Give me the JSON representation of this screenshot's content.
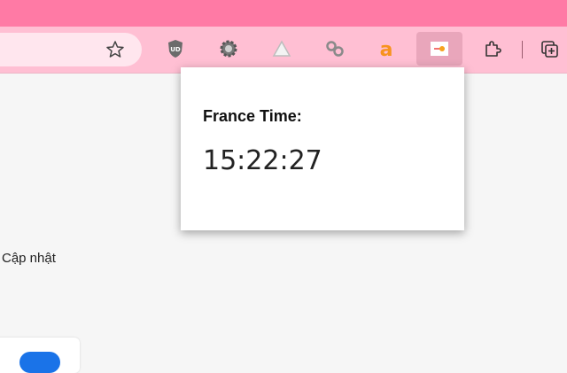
{
  "browser": {
    "toolbar_icons": [
      {
        "name": "star-icon"
      },
      {
        "name": "ublock-icon",
        "label": "UD"
      },
      {
        "name": "gear-icon"
      },
      {
        "name": "triangle-icon"
      },
      {
        "name": "link-icon"
      },
      {
        "name": "amazon-icon",
        "label": "a"
      },
      {
        "name": "france-time-icon"
      },
      {
        "name": "extensions-puzzle-icon"
      },
      {
        "name": "collections-icon"
      }
    ]
  },
  "page": {
    "side_text": "Cập nhật"
  },
  "popup": {
    "label": "France Time:",
    "time": "15:22:27"
  },
  "colors": {
    "titlebar": "#ff7aa5",
    "toolbar": "#ffbfd3",
    "toggle_accent": "#1a73e8"
  }
}
